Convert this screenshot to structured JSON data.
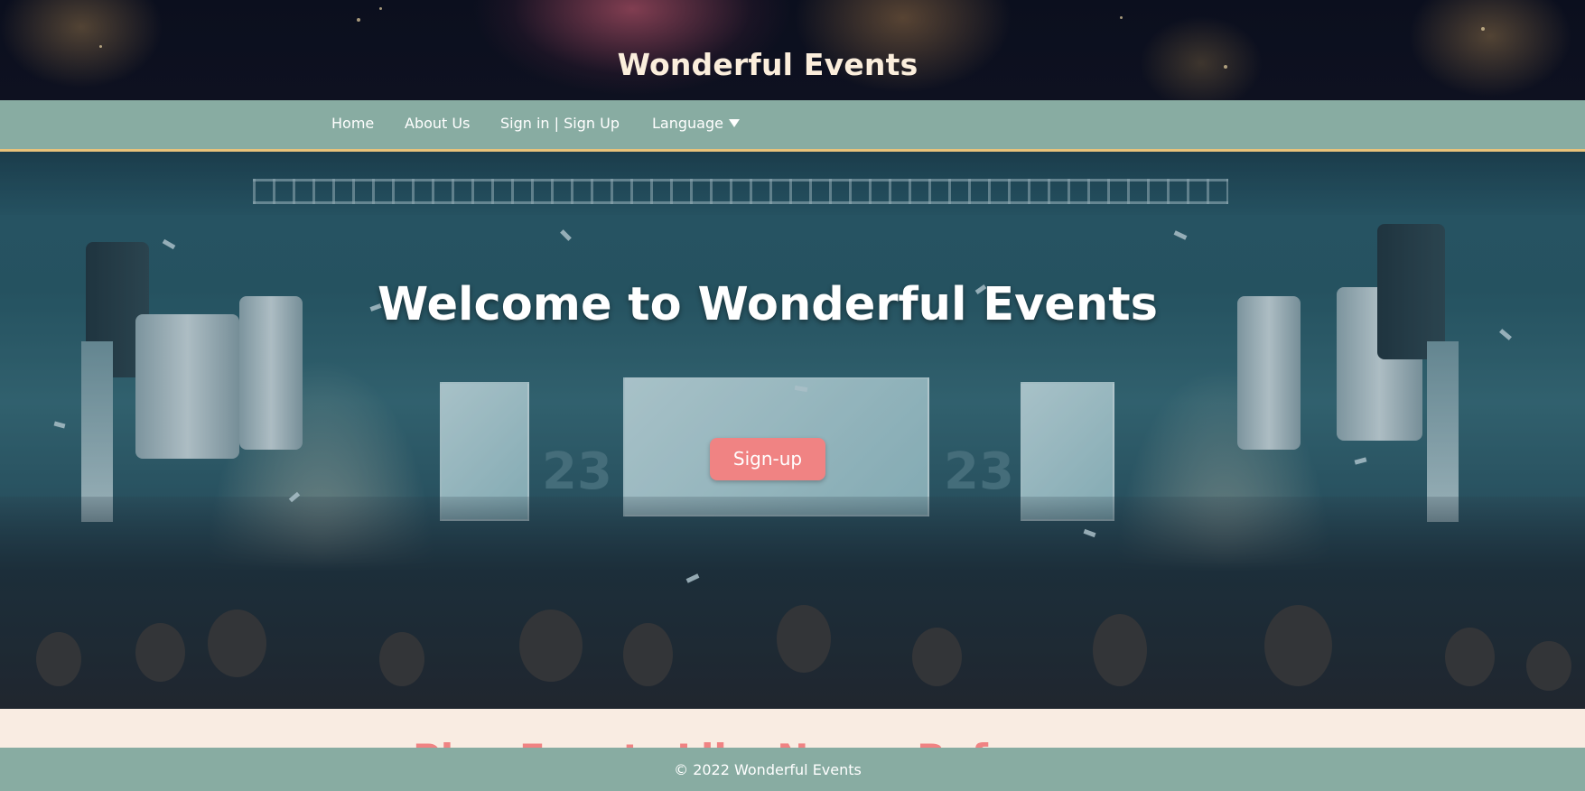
{
  "header": {
    "title": "Wonderful Events"
  },
  "nav": {
    "items": [
      {
        "label": "Home"
      },
      {
        "label": "About Us"
      },
      {
        "label": "Sign in | Sign Up"
      },
      {
        "label": "Language"
      }
    ],
    "language_icon": "chevron-down-icon"
  },
  "hero": {
    "title": "Welcome to Wonderful Events",
    "signup_label": "Sign-up",
    "screen_numbers": [
      "23",
      "23"
    ]
  },
  "section": {
    "heading": "Plan Events Like Never Before"
  },
  "footer": {
    "text": "© 2022 Wonderful Events"
  },
  "colors": {
    "nav_bg": "#88aca2",
    "nav_border": "#e8c27a",
    "button_bg": "#f08383",
    "page_bg": "#f9ece2",
    "title_text": "#fbeedc"
  }
}
